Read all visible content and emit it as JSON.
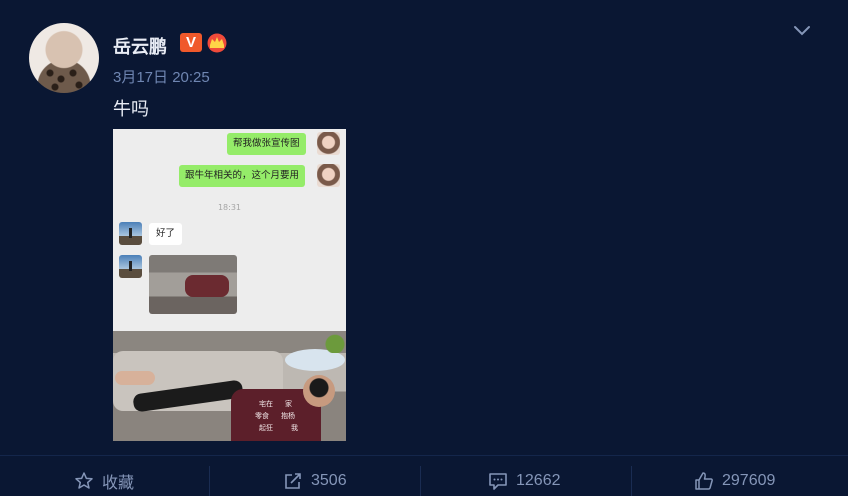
{
  "post": {
    "username": "岳云鹏",
    "verified_badge": "V",
    "timestamp": "3月17日 20:25",
    "text": "牛吗"
  },
  "media": {
    "chat": {
      "messages": [
        {
          "side": "right",
          "text": "帮我做张宣传图"
        },
        {
          "side": "right",
          "text": "跟牛年相关的，这个月要用"
        },
        {
          "side": "left",
          "text": "好了"
        }
      ],
      "time": "18:31"
    },
    "photo_words": [
      "宅在",
      "家",
      "零食",
      "抱杨",
      "起狂",
      "我"
    ]
  },
  "actions": {
    "favorite": "收藏",
    "repost": "3506",
    "comment": "12662",
    "like": "297609"
  },
  "colors": {
    "background": "#0a1733",
    "accent_text": "#6f86b2",
    "v_badge": "#f0592b",
    "wechat_green": "#95ec69"
  },
  "icons": [
    "chevron-down-icon",
    "star-icon",
    "share-icon",
    "comment-icon",
    "thumbs-up-icon",
    "crown-badge-icon"
  ]
}
